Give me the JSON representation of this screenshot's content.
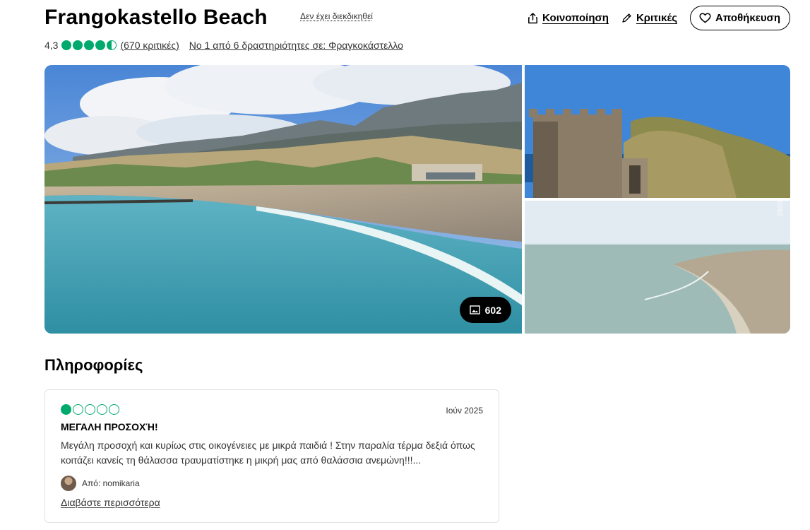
{
  "header": {
    "title": "Frangokastello Beach",
    "claim_status": "Δεν έχει διεκδικηθεί",
    "share_label": "Κοινοποίηση",
    "reviews_label": "Κριτικές",
    "save_label": "Αποθήκευση"
  },
  "rating": {
    "score": "4,3",
    "bubbles_value": 4.5,
    "review_count": "(670 κριτικές)",
    "ranking": "Νο 1 από 6 δραστηριότητες σε: Φραγκοκάστελλο"
  },
  "gallery": {
    "photo_count": "602",
    "watermark": "2020"
  },
  "info": {
    "section_title": "Πληροφορίες"
  },
  "review": {
    "bubbles_value": 1,
    "date": "Ιούν 2025",
    "title": "ΜΕΓΑΛΗ ΠΡΟΣΟΧΉ!",
    "text": "Μεγάλη προσοχή και κυρίως στις οικογένειες με μικρά παιδιά ! Στην παραλία τέρμα δεξιά όπως κοιτάζει κανείς τη θάλασσα τραυματίστηκε η μικρή μας από θαλάσσια ανεμώνη!!!...",
    "author": "Από: nomikaria",
    "read_more": "Διαβάστε περισσότερα"
  },
  "colors": {
    "bubble_green": "#00aa6c"
  }
}
